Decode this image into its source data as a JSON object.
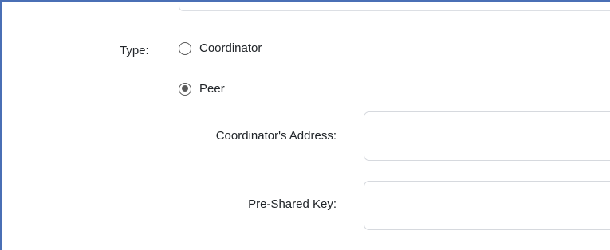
{
  "form": {
    "type_label": "Type:",
    "type_options": [
      {
        "label": "Coordinator",
        "selected": false
      },
      {
        "label": "Peer",
        "selected": true
      }
    ],
    "coordinator_address": {
      "label": "Coordinator's Address:",
      "value": "",
      "placeholder": ""
    },
    "pre_shared_key": {
      "label": "Pre-Shared Key:",
      "value": "",
      "placeholder": ""
    }
  },
  "colors": {
    "frame_border": "#4a6fb5",
    "input_border": "#d6d9de",
    "radio": "#5a5a5a",
    "text": "#212529"
  }
}
